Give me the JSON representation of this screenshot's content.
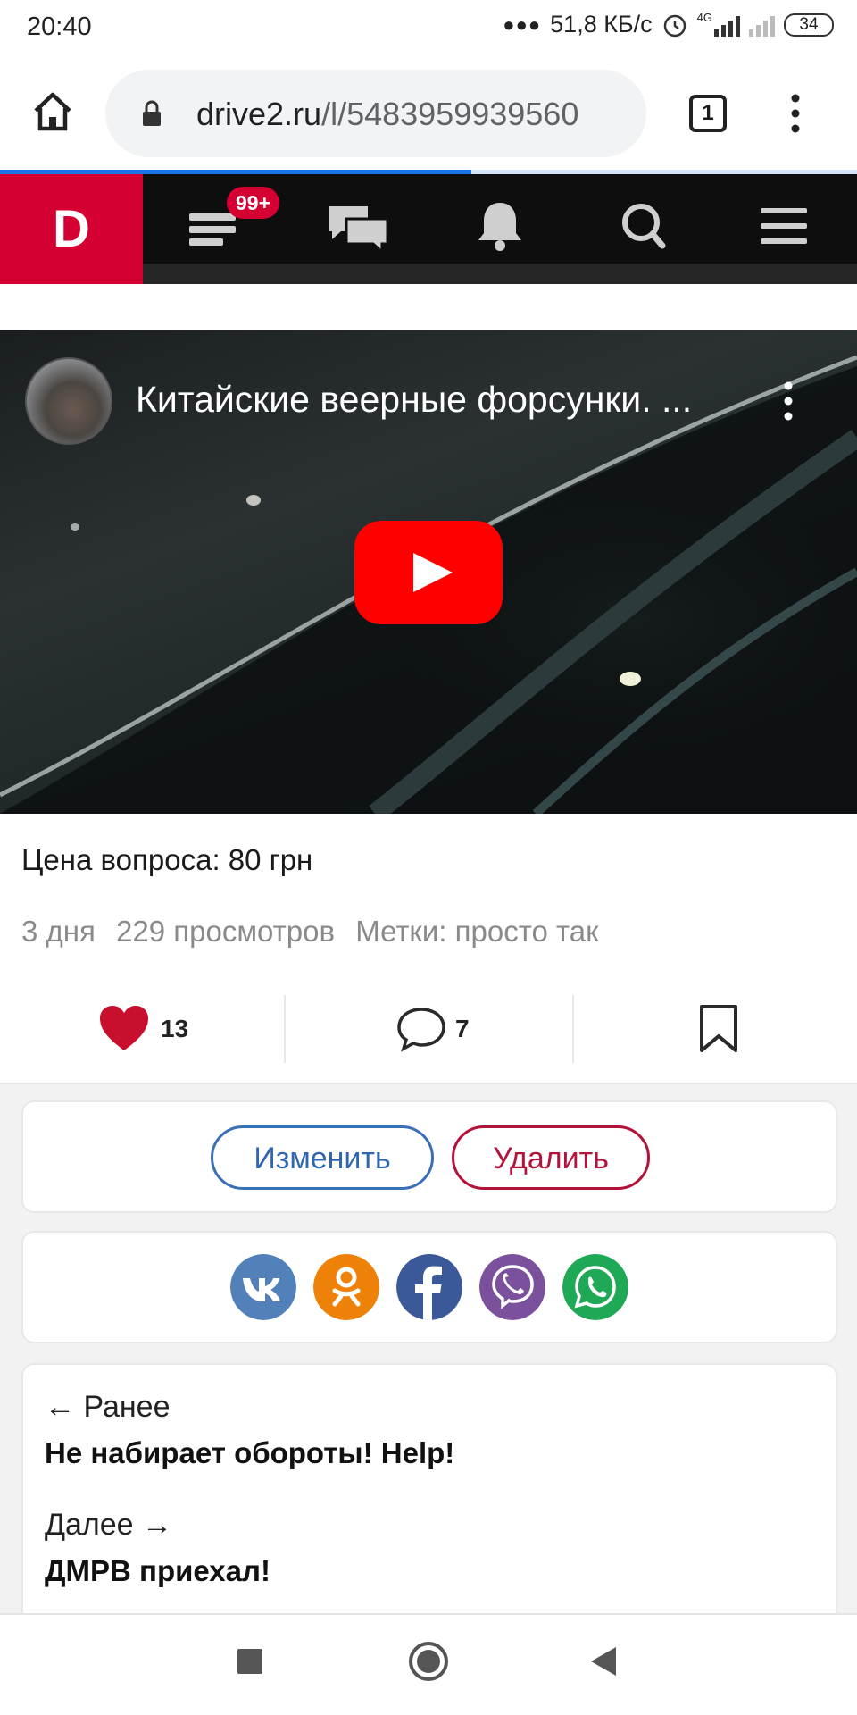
{
  "status_bar": {
    "time": "20:40",
    "net_speed": "51,8 КБ/с",
    "network_type": "4G",
    "battery": "34"
  },
  "browser": {
    "url_domain": "drive2.ru",
    "url_path": "/l/5483959939560",
    "tab_count": "1",
    "page_load_progress": 0.55
  },
  "site_nav": {
    "logo": "D",
    "feed_badge": "99+"
  },
  "video": {
    "title": "Китайские веерные форсунки. ...",
    "play_icon": "youtube-play-icon"
  },
  "post": {
    "price_line": "Цена вопроса: 80 грн",
    "age": "3 дня",
    "views": "229 просмотров",
    "tags": "Метки: просто так"
  },
  "actions": {
    "likes": "13",
    "comments": "7"
  },
  "owner_controls": {
    "edit_label": "Изменить",
    "delete_label": "Удалить"
  },
  "share": {
    "networks": [
      "vk",
      "odnoklassniki",
      "facebook",
      "viber",
      "whatsapp"
    ]
  },
  "pagination": {
    "prev_label": "← Ранее",
    "prev_title": "Не набирает обороты! Help!",
    "next_label": "Далее →",
    "next_title": "ДМРВ приехал!"
  },
  "colors": {
    "brand_red": "#d50032",
    "link_blue": "#2f66b0",
    "vk": "#5181b8",
    "ok": "#ee8208",
    "facebook": "#3b5998",
    "viber": "#7b519d",
    "whatsapp": "#1fa855"
  }
}
